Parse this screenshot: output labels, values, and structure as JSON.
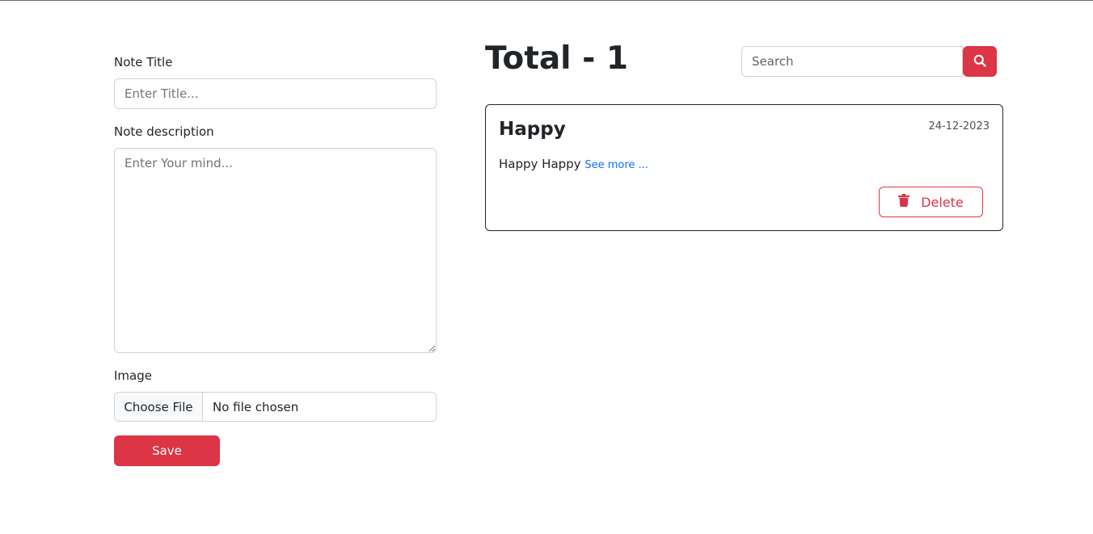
{
  "form": {
    "title_label": "Note Title",
    "title_placeholder": "Enter Title...",
    "title_value": "",
    "description_label": "Note description",
    "description_placeholder": "Enter Your mind...",
    "description_value": "",
    "image_label": "Image",
    "file_button_label": "Choose File",
    "file_status": "No file chosen",
    "save_label": "Save"
  },
  "notes_panel": {
    "total_text": "Total - 1",
    "search_placeholder": "Search",
    "search_icon": "search-icon",
    "notes": [
      {
        "title": "Happy",
        "date": "24-12-2023",
        "body": "Happy Happy",
        "see_more": "See more ...",
        "delete_label": "Delete",
        "delete_icon": "trash-icon"
      }
    ]
  },
  "colors": {
    "accent": "#dc3545",
    "link": "#0d6efd",
    "border": "#ced4da",
    "text": "#212529"
  }
}
